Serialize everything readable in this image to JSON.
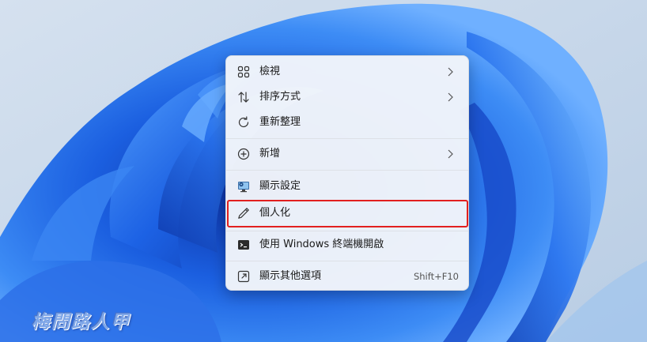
{
  "desktop": {
    "wallpaper": "Windows 11 blue bloom"
  },
  "context_menu": {
    "items": [
      {
        "label": "檢視",
        "icon": "grid-view-icon",
        "has_submenu": true
      },
      {
        "label": "排序方式",
        "icon": "sort-arrows-icon",
        "has_submenu": true
      },
      {
        "label": "重新整理",
        "icon": "refresh-icon",
        "has_submenu": false
      },
      {
        "label": "新增",
        "icon": "add-circle-icon",
        "has_submenu": true
      },
      {
        "label": "顯示設定",
        "icon": "display-settings-icon",
        "has_submenu": false
      },
      {
        "label": "個人化",
        "icon": "pencil-icon",
        "has_submenu": false
      },
      {
        "label": "使用 Windows 終端機開啟",
        "icon": "terminal-icon",
        "has_submenu": false
      },
      {
        "label": "顯示其他選項",
        "icon": "show-more-options-icon",
        "shortcut": "Shift+F10"
      }
    ]
  },
  "highlight": {
    "target": "個人化",
    "color": "#e21f1f"
  },
  "watermark": {
    "text": "梅問路人甲"
  },
  "colors": {
    "accent": "#0a5bd6",
    "highlight_border": "#e21f1f"
  }
}
